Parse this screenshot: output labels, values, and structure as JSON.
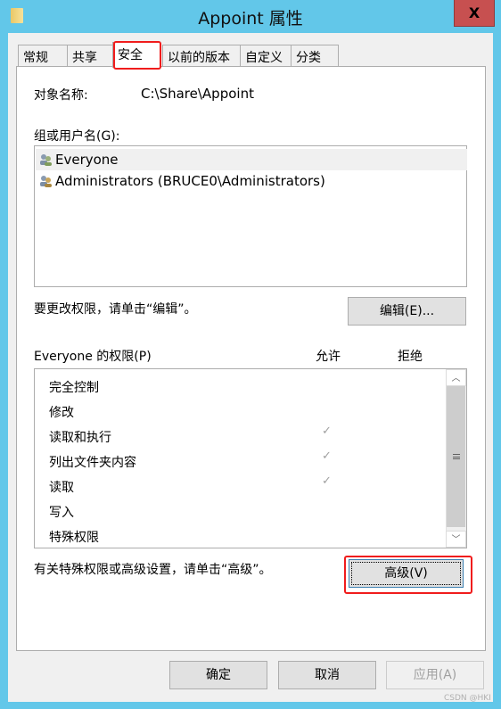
{
  "window": {
    "title": "Appoint 属性",
    "close_label": "X"
  },
  "tabs": [
    {
      "label": "常规"
    },
    {
      "label": "共享"
    },
    {
      "label": "安全",
      "active": true
    },
    {
      "label": "以前的版本"
    },
    {
      "label": "自定义"
    },
    {
      "label": "分类"
    }
  ],
  "security": {
    "object_name_label": "对象名称:",
    "object_name_value": "C:\\Share\\Appoint",
    "group_label": "组或用户名(G):",
    "users": [
      {
        "name": "Everyone",
        "selected": true
      },
      {
        "name": "Administrators (BRUCE0\\Administrators)"
      }
    ],
    "edit_hint": "要更改权限，请单击“编辑”。",
    "edit_button": "编辑(E)...",
    "perm_header": "Everyone 的权限(P)",
    "allow_header": "允许",
    "deny_header": "拒绝",
    "permissions": [
      {
        "name": "完全控制",
        "allow": false
      },
      {
        "name": "修改",
        "allow": false
      },
      {
        "name": "读取和执行",
        "allow": true
      },
      {
        "name": "列出文件夹内容",
        "allow": true
      },
      {
        "name": "读取",
        "allow": true
      },
      {
        "name": "写入",
        "allow": false
      },
      {
        "name": "特殊权限",
        "allow": false
      }
    ],
    "check_glyph": "✓",
    "advanced_hint": "有关特殊权限或高级设置，请单击“高级”。",
    "advanced_button": "高级(V)"
  },
  "footer": {
    "ok": "确定",
    "cancel": "取消",
    "apply": "应用(A)"
  },
  "watermark": "CSDN @HKI",
  "colors": {
    "titlebar": "#62c7e9",
    "close": "#c75050",
    "highlight": "#f01c1c"
  }
}
